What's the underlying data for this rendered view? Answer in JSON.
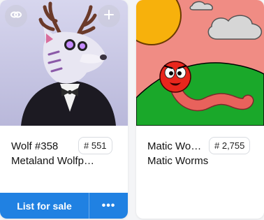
{
  "cards": [
    {
      "title": "Wolf #358",
      "collection": "Metaland Wolfp…",
      "token_number": "# 551",
      "actions": {
        "primary_label": "List for sale",
        "more_label": "•••"
      },
      "top_left_icon": "link-icon",
      "top_right_icon": "plus-icon"
    },
    {
      "title": "Matic Wo…",
      "collection": "Matic Worms",
      "token_number": "# 2,755"
    }
  ],
  "colors": {
    "accent": "#2081e2",
    "card_bg": "#ffffff",
    "page_bg": "#f4f5f7",
    "worm_sky": "#f08c84",
    "worm_grass": "#1aa82a"
  }
}
